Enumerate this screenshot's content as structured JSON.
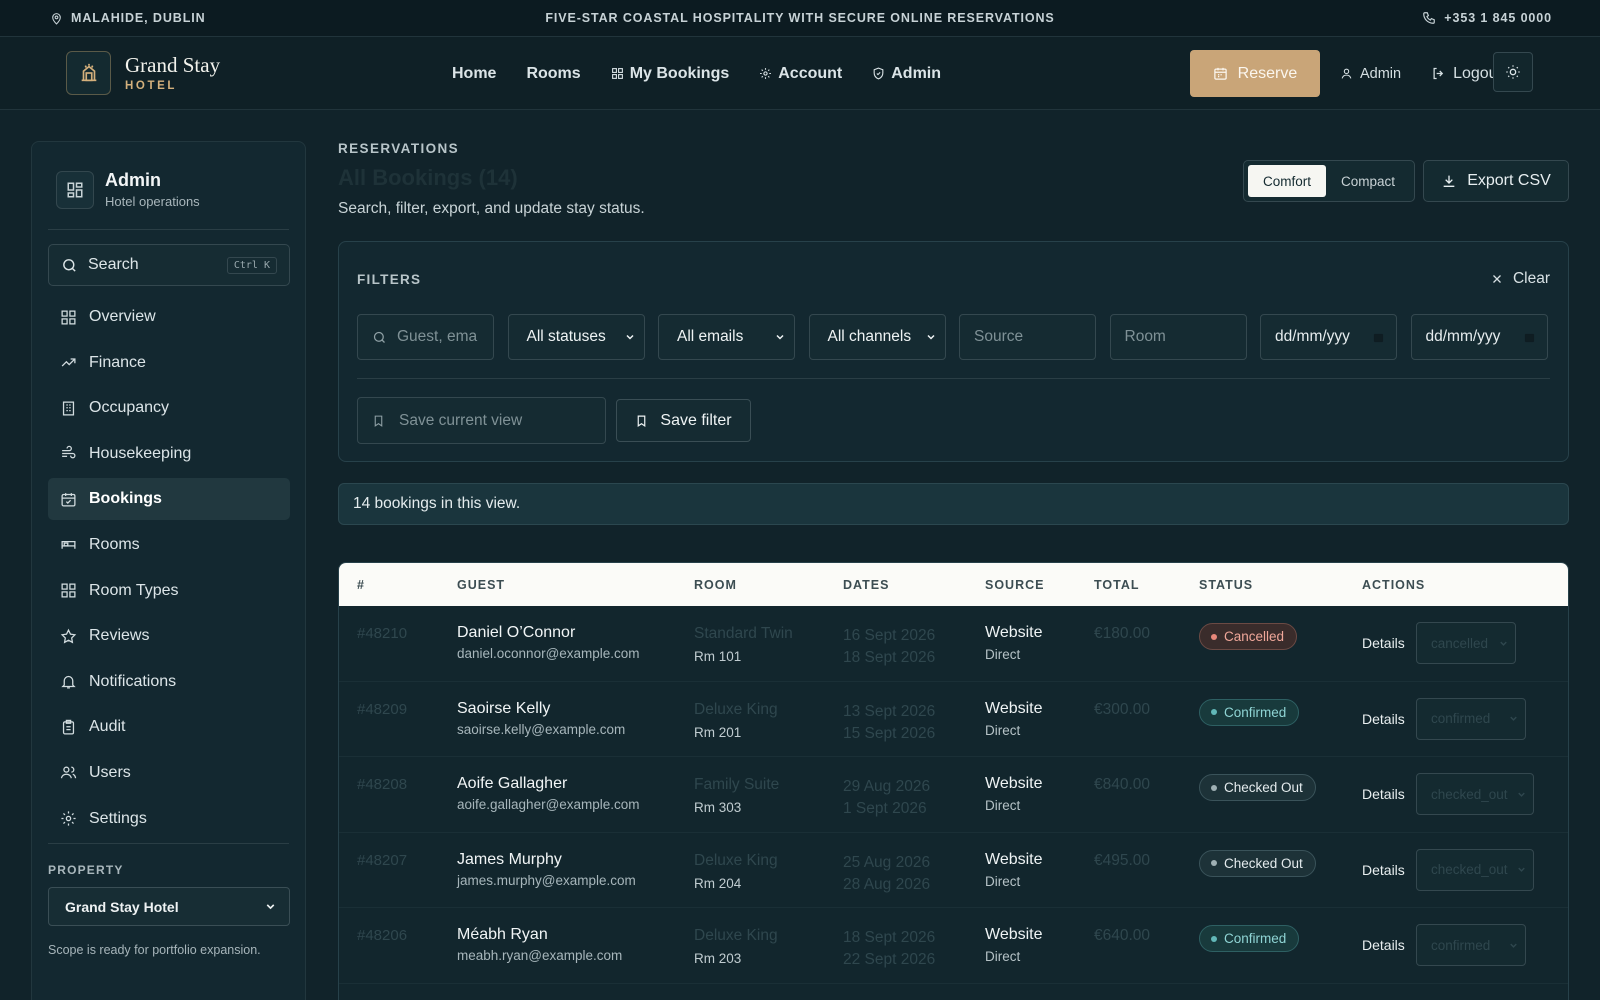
{
  "topbar": {
    "location": "MALAHIDE, DUBLIN",
    "tagline": "FIVE-STAR COASTAL HOSPITALITY WITH SECURE ONLINE RESERVATIONS",
    "phone": "+353 1 845 0000"
  },
  "brand": {
    "name": "Grand Stay",
    "sub": "HOTEL"
  },
  "nav": {
    "home": "Home",
    "rooms": "Rooms",
    "my_bookings": "My Bookings",
    "account": "Account",
    "admin": "Admin"
  },
  "header_actions": {
    "reserve": "Reserve",
    "user": "Admin",
    "logout": "Logout"
  },
  "sidebar": {
    "title": "Admin",
    "subtitle": "Hotel operations",
    "search_label": "Search",
    "search_shortcut": "Ctrl K",
    "items": [
      {
        "label": "Overview",
        "icon": "grid-icon"
      },
      {
        "label": "Finance",
        "icon": "trend-icon"
      },
      {
        "label": "Occupancy",
        "icon": "building-icon"
      },
      {
        "label": "Housekeeping",
        "icon": "wind-icon"
      },
      {
        "label": "Bookings",
        "icon": "calendar-check-icon",
        "active": true
      },
      {
        "label": "Rooms",
        "icon": "bed-icon"
      },
      {
        "label": "Room Types",
        "icon": "grid-icon"
      },
      {
        "label": "Reviews",
        "icon": "star-icon"
      },
      {
        "label": "Notifications",
        "icon": "bell-icon"
      },
      {
        "label": "Audit",
        "icon": "clipboard-icon"
      },
      {
        "label": "Users",
        "icon": "users-icon"
      },
      {
        "label": "Settings",
        "icon": "gear-icon"
      }
    ],
    "property_label": "PROPERTY",
    "property_value": "Grand Stay Hotel",
    "property_note": "Scope is ready for portfolio expansion."
  },
  "page": {
    "eyebrow": "RESERVATIONS",
    "title": "All Bookings (14)",
    "subtitle": "Search, filter, export, and update stay status.",
    "density_comfort": "Comfort",
    "density_compact": "Compact",
    "export": "Export CSV"
  },
  "filters": {
    "title": "FILTERS",
    "clear": "Clear",
    "guest_placeholder": "Guest, ema",
    "status_value": "All statuses",
    "email_value": "All emails",
    "channel_value": "All channels",
    "source_placeholder": "Source",
    "room_placeholder": "Room",
    "date_from": "dd/mm/yyy",
    "date_to": "dd/mm/yyy",
    "save_view_placeholder": "Save current view",
    "save_filter": "Save filter"
  },
  "summary": "14 bookings in this view.",
  "table": {
    "headers": {
      "id": "#",
      "guest": "GUEST",
      "room": "ROOM",
      "dates": "DATES",
      "source": "SOURCE",
      "total": "TOTAL",
      "status": "STATUS",
      "actions": "ACTIONS"
    },
    "details_label": "Details",
    "rows": [
      {
        "id": "#48210",
        "name": "Daniel O’Connor",
        "email": "daniel.oconnor@example.com",
        "room_type": "Standard Twin",
        "room_no": "Rm 101",
        "check_in": "16 Sept 2026",
        "check_out": "18 Sept 2026",
        "source": "Website",
        "channel": "Direct",
        "total": "€180.00",
        "status": "Cancelled",
        "status_value": "cancelled"
      },
      {
        "id": "#48209",
        "name": "Saoirse Kelly",
        "email": "saoirse.kelly@example.com",
        "room_type": "Deluxe King",
        "room_no": "Rm 201",
        "check_in": "13 Sept 2026",
        "check_out": "15 Sept 2026",
        "source": "Website",
        "channel": "Direct",
        "total": "€300.00",
        "status": "Confirmed",
        "status_value": "confirmed"
      },
      {
        "id": "#48208",
        "name": "Aoife Gallagher",
        "email": "aoife.gallagher@example.com",
        "room_type": "Family Suite",
        "room_no": "Rm 303",
        "check_in": "29 Aug 2026",
        "check_out": "1 Sept 2026",
        "source": "Website",
        "channel": "Direct",
        "total": "€840.00",
        "status": "Checked Out",
        "status_value": "checked_out"
      },
      {
        "id": "#48207",
        "name": "James Murphy",
        "email": "james.murphy@example.com",
        "room_type": "Deluxe King",
        "room_no": "Rm 204",
        "check_in": "25 Aug 2026",
        "check_out": "28 Aug 2026",
        "source": "Website",
        "channel": "Direct",
        "total": "€495.00",
        "status": "Checked Out",
        "status_value": "checked_out"
      },
      {
        "id": "#48206",
        "name": "Méabh Ryan",
        "email": "meabh.ryan@example.com",
        "room_type": "Deluxe King",
        "room_no": "Rm 203",
        "check_in": "18 Sept 2026",
        "check_out": "22 Sept 2026",
        "source": "Website",
        "channel": "Direct",
        "total": "€640.00",
        "status": "Confirmed",
        "status_value": "confirmed"
      }
    ]
  },
  "colors": {
    "accent": "#c9a578",
    "background": "#11232a",
    "cancelled": "#e8877a",
    "confirmed": "#62b8b8"
  }
}
